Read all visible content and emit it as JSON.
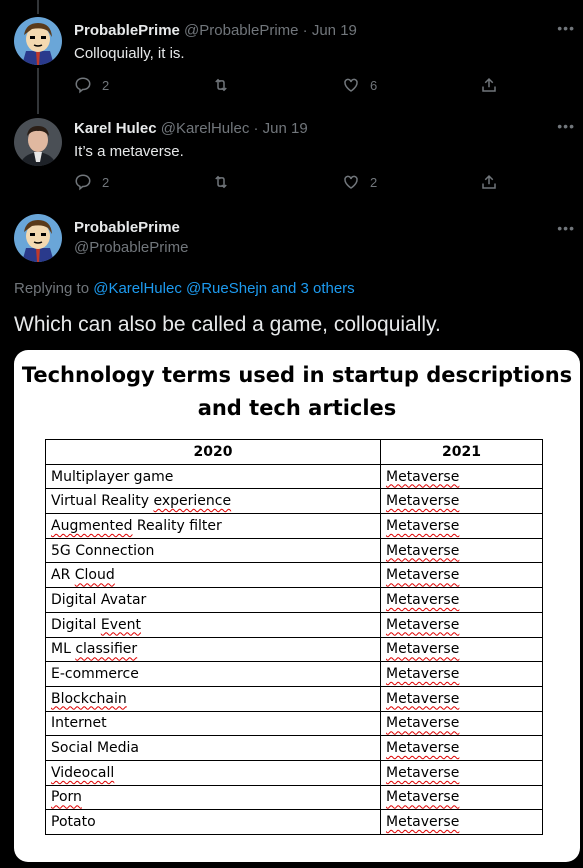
{
  "tweets": [
    {
      "name": "ProbablePrime",
      "handle": "@ProbablePrime",
      "date": "Jun 19",
      "text": "Colloquially, it is.",
      "replies": "2",
      "retweets": "",
      "likes": "6"
    },
    {
      "name": "Karel Hulec",
      "handle": "@KarelHulec",
      "date": "Jun 19",
      "text": "It’s a metaverse.",
      "replies": "2",
      "retweets": "",
      "likes": "2"
    }
  ],
  "main": {
    "name": "ProbablePrime",
    "handle": "@ProbablePrime",
    "replying_prefix": "Replying to",
    "replying_users": "@KarelHulec @RueShejn",
    "replying_and": "and",
    "replying_others": "3 others",
    "text": "Which can also be called a game, colloquially."
  },
  "image": {
    "title_line1": "Technology terms used in startup descriptions",
    "title_line2": "and tech articles",
    "headers": [
      "2020",
      "2021"
    ],
    "rows": [
      [
        "Multiplayer game",
        "Metaverse"
      ],
      [
        "Virtual Reality experience",
        "Metaverse"
      ],
      [
        "Augmented Reality filter",
        "Metaverse"
      ],
      [
        "5G Connection",
        "Metaverse"
      ],
      [
        "AR Cloud",
        "Metaverse"
      ],
      [
        "Digital Avatar",
        "Metaverse"
      ],
      [
        "Digital Event",
        "Metaverse"
      ],
      [
        "ML classifier",
        "Metaverse"
      ],
      [
        "E-commerce",
        "Metaverse"
      ],
      [
        "Blockchain",
        "Metaverse"
      ],
      [
        "Internet",
        "Metaverse"
      ],
      [
        "Social Media",
        "Metaverse"
      ],
      [
        "Videocall",
        "Metaverse"
      ],
      [
        "Porn",
        "Metaverse"
      ],
      [
        "Potato",
        "Metaverse"
      ]
    ]
  },
  "icons": {
    "reply": "reply-icon",
    "retweet": "retweet-icon",
    "like": "heart-icon",
    "share": "share-icon",
    "more": "more-icon"
  },
  "colors": {
    "background": "#000000",
    "text": "#e7e9ea",
    "muted": "#71767b",
    "link": "#1d9bf0",
    "spellcheck": "#dd0000"
  }
}
